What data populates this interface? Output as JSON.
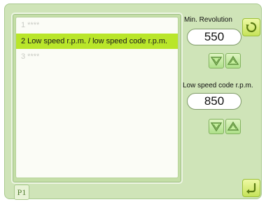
{
  "list": {
    "items": [
      {
        "label": "1 ****",
        "selected": false
      },
      {
        "label": "2 Low speed r.p.m. / low speed code r.p.m.",
        "selected": true
      },
      {
        "label": "3 ****",
        "selected": false
      }
    ]
  },
  "page_tab": {
    "label": "P1"
  },
  "params": {
    "min_revolution": {
      "label": "Min. Revolution",
      "value": "550"
    },
    "low_speed_code": {
      "label": "Low speed code r.p.m.",
      "value": "850"
    }
  },
  "icons": {
    "arrow_down": "down-arrow-icon",
    "arrow_up": "up-arrow-icon",
    "reset": "reset-icon",
    "enter": "enter-icon"
  },
  "colors": {
    "panel": "#cfe4b8",
    "selected_row": "#b9e62a",
    "button_green": "#aee08a",
    "corner_button": "#c6e35a"
  }
}
